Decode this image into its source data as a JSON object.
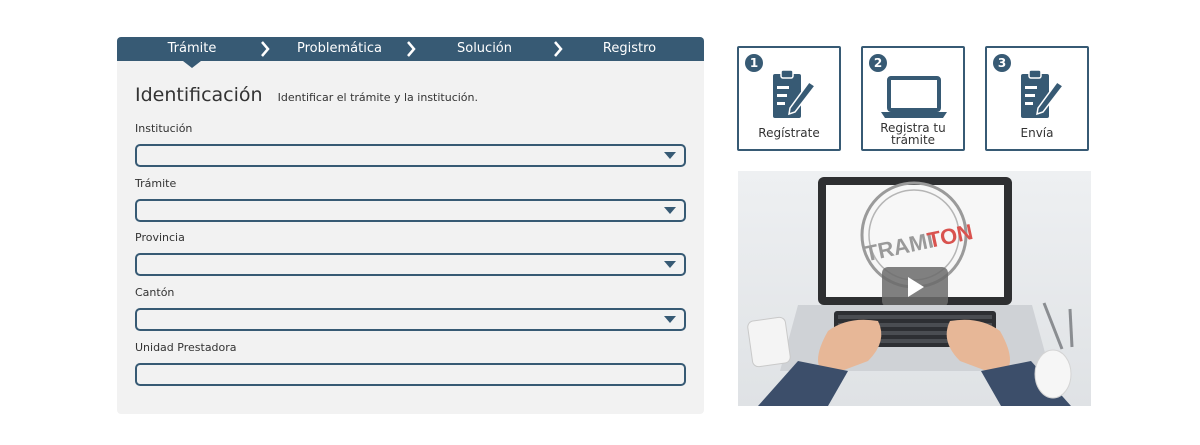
{
  "steps": {
    "step1": "Trámite",
    "step2": "Problemática",
    "step3": "Solución",
    "step4": "Registro"
  },
  "form": {
    "title": "Identificación",
    "subtitle": "Identificar el trámite y la institución.",
    "fields": [
      {
        "label": "Institución",
        "value": ""
      },
      {
        "label": "Trámite",
        "value": ""
      },
      {
        "label": "Provincia",
        "value": ""
      },
      {
        "label": "Cantón",
        "value": ""
      },
      {
        "label": "Unidad Prestadora",
        "value": ""
      }
    ]
  },
  "cards": [
    {
      "number": "1",
      "label": "Regístrate",
      "icon": "clipboard-pen-icon"
    },
    {
      "number": "2",
      "label_line1": "Registra tu",
      "label_line2": "trámite",
      "icon": "laptop-icon"
    },
    {
      "number": "3",
      "label": "Envía",
      "icon": "clipboard-pen-icon"
    }
  ],
  "video": {
    "logo_text_left": "TRAMI",
    "logo_text_right": "TON",
    "icon": "play-icon"
  },
  "colors": {
    "primary": "#375a74",
    "panel_bg": "#f2f2f2",
    "logo_red": "#d9534f"
  }
}
